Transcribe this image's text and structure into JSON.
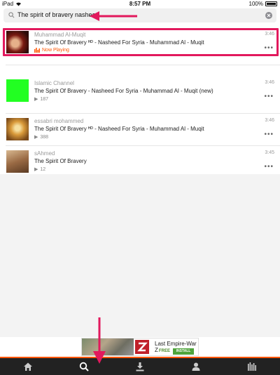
{
  "status_bar": {
    "device": "iPad",
    "time": "8:57 PM",
    "battery": "100%"
  },
  "search": {
    "query": "The spirit of bravery nasheed"
  },
  "results": [
    {
      "author": "Muhammad Al-Muqit",
      "title": "The Spirit Of Bravery ᴴᴰ - Nasheed For Syria - Muhammad Al - Muqit",
      "status": "Now Playing",
      "duration": "3:46"
    },
    {
      "author": "Islamic Channel",
      "title": "The Spirit Of Bravery - Nasheed For Syria - Muhammad Al - Muqit (new)",
      "plays": "187",
      "duration": "3:46"
    },
    {
      "author": "essabri mohammed",
      "title": "The Spirit Of Bravery ᴴᴰ - Nasheed For Syria - Muhammad Al - Muqit",
      "plays": "388",
      "duration": "3:46"
    },
    {
      "author": "sAhmed",
      "title": "The Spirit Of Bravery",
      "plays": "12",
      "duration": "3:45"
    }
  ],
  "ad": {
    "title": "Last Empire-War Z",
    "free": "FREE",
    "install": "INSTALL"
  },
  "tabs": [
    "home",
    "search",
    "downloads",
    "profile",
    "library"
  ],
  "colors": {
    "accent": "#ff5500",
    "annotation": "#e2195d"
  }
}
